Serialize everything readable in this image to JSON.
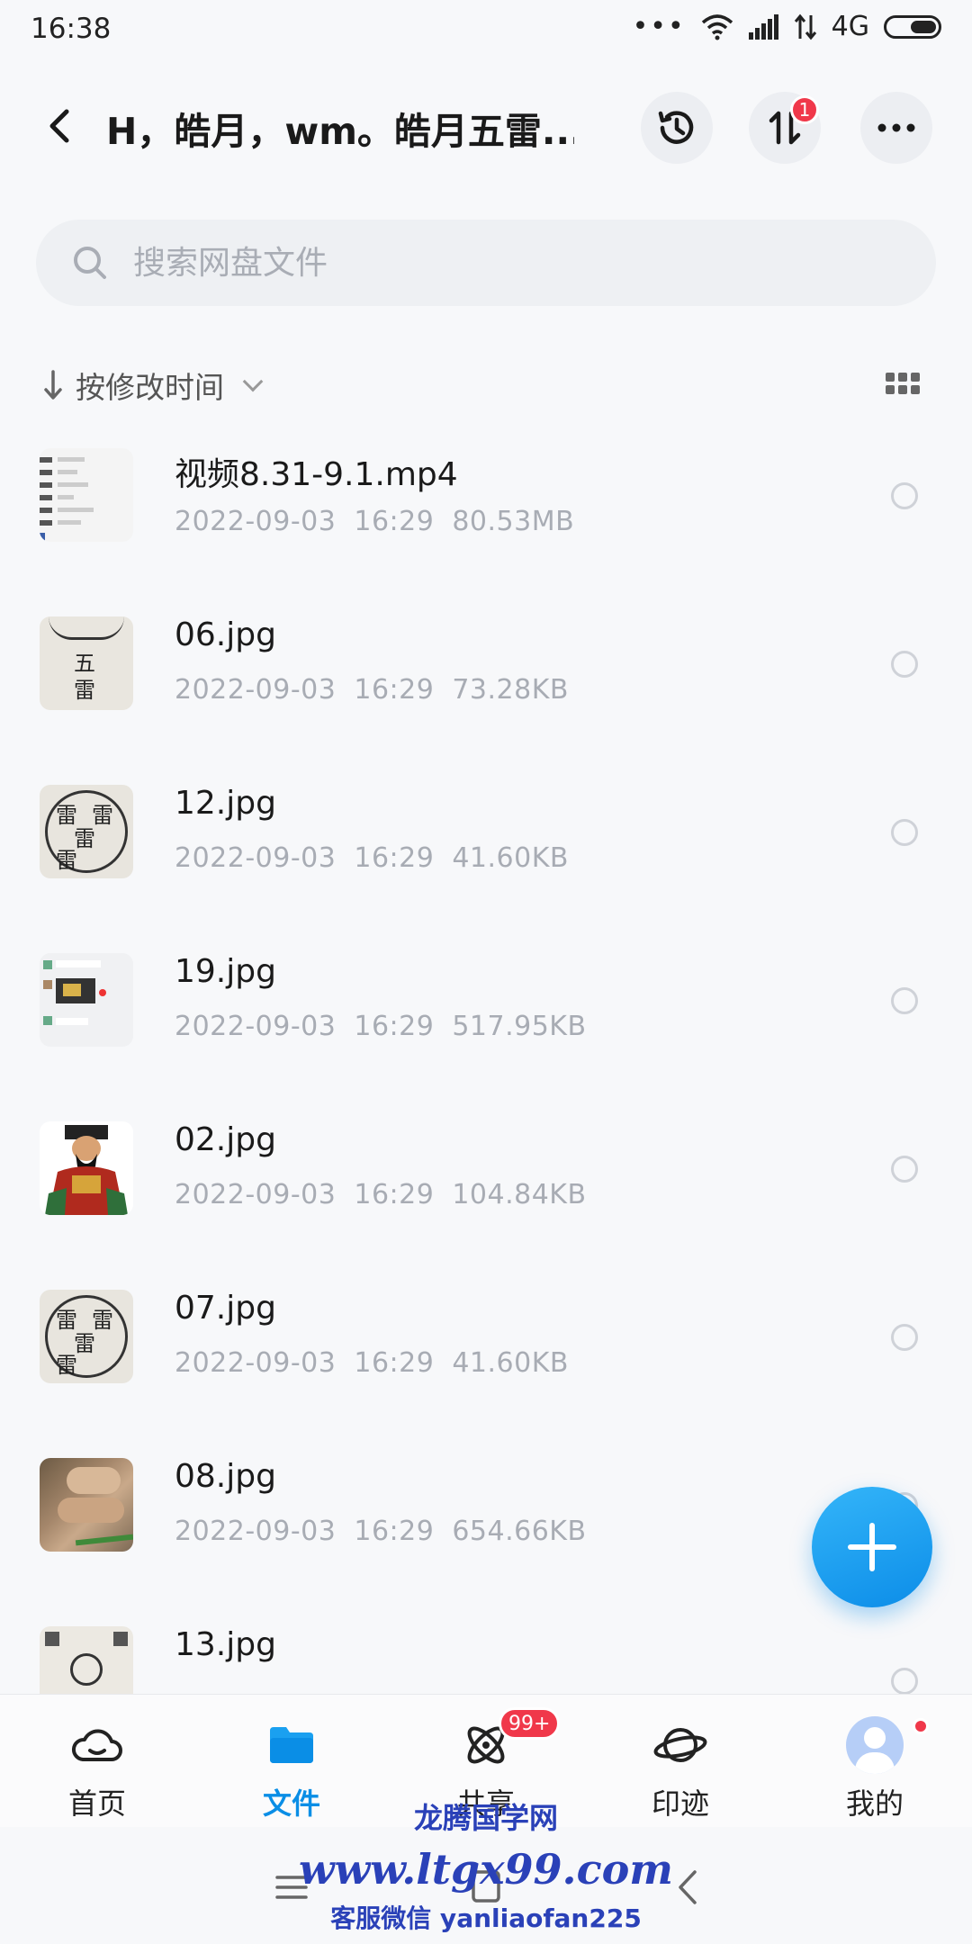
{
  "status_bar": {
    "time": "16:38",
    "dots": "•••",
    "network": "4G",
    "icons": [
      "wifi-icon",
      "signal-icon",
      "data-arrows-icon",
      "battery-icon"
    ]
  },
  "header": {
    "title": "H，皓月，wm。皓月五雷...",
    "transfer_badge": "1",
    "icons": [
      "back-arrow-icon",
      "history-icon",
      "transfer-icon",
      "more-icon"
    ]
  },
  "search": {
    "placeholder": "搜索网盘文件",
    "value": ""
  },
  "sort": {
    "label": "按修改时间"
  },
  "files": [
    {
      "name": "视频8.31-9.1.mp4",
      "date": "2022-09-03",
      "time": "16:29",
      "size": "80.53MB",
      "thumb": "video"
    },
    {
      "name": "06.jpg",
      "date": "2022-09-03",
      "time": "16:29",
      "size": "73.28KB",
      "thumb": "paper"
    },
    {
      "name": "12.jpg",
      "date": "2022-09-03",
      "time": "16:29",
      "size": "41.60KB",
      "thumb": "circle"
    },
    {
      "name": "19.jpg",
      "date": "2022-09-03",
      "time": "16:29",
      "size": "517.95KB",
      "thumb": "chat"
    },
    {
      "name": "02.jpg",
      "date": "2022-09-03",
      "time": "16:29",
      "size": "104.84KB",
      "thumb": "figure"
    },
    {
      "name": "07.jpg",
      "date": "2022-09-03",
      "time": "16:29",
      "size": "41.60KB",
      "thumb": "circle"
    },
    {
      "name": "08.jpg",
      "date": "2022-09-03",
      "time": "16:29",
      "size": "654.66KB",
      "thumb": "hand"
    },
    {
      "name": "13.jpg",
      "date": "",
      "time": "",
      "size": "",
      "thumb": "seal"
    }
  ],
  "thumb_glyphs": {
    "paper": [
      "五",
      "雷"
    ],
    "circle": [
      "雷",
      "雷",
      "雷",
      "雷"
    ]
  },
  "bottom_nav": [
    {
      "label": "首页",
      "icon": "cloud-icon",
      "active": false
    },
    {
      "label": "文件",
      "icon": "folder-icon",
      "active": true
    },
    {
      "label": "共享",
      "icon": "atom-icon",
      "active": false,
      "badge": "99+"
    },
    {
      "label": "印迹",
      "icon": "planet-icon",
      "active": false
    },
    {
      "label": "我的",
      "icon": "avatar-icon",
      "active": false,
      "dot": true
    }
  ],
  "watermark": {
    "line1": "龙腾国学网",
    "line2": "www.ltgx99.com",
    "line3": "客服微信 yanliaofan225"
  },
  "colors": {
    "accent": "#0a8ee6",
    "badge": "#f0384a",
    "meta_text": "#a8acb4",
    "background": "#f7f8fa"
  }
}
